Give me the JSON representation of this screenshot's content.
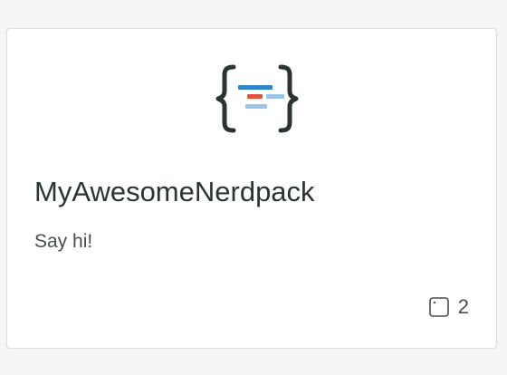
{
  "card": {
    "title": "MyAwesomeNerdpack",
    "description": "Say hi!",
    "launcher_count": "2",
    "icons": {
      "logo": "nerdpack-braces-icon",
      "launcher": "launcher-square-icon"
    },
    "colors": {
      "bracket": "#2a3434",
      "line_blue": "#2f86c9",
      "line_red": "#e0553c",
      "line_light_blue": "#9cc4e4",
      "title": "#2a3434",
      "text": "#464e4e",
      "border": "#d8dcdd"
    }
  }
}
